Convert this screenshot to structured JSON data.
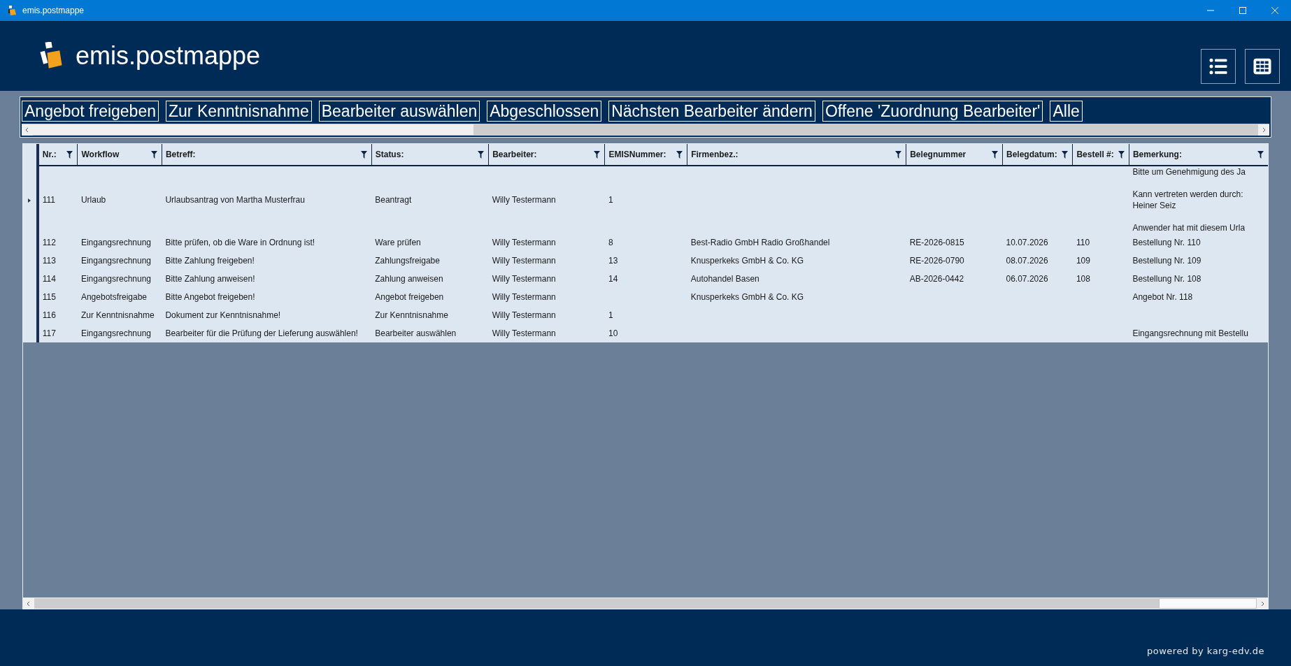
{
  "window": {
    "title": "emis.postmappe"
  },
  "app": {
    "name": "emis.postmappe"
  },
  "view_buttons": [
    {
      "kind": "list"
    },
    {
      "kind": "grid"
    }
  ],
  "filters": [
    "Angebot freigeben",
    "Zur Kenntnisnahme",
    "Bearbeiter auswählen",
    "Abgeschlossen",
    "Nächsten Bearbeiter ändern",
    "Offene 'Zuordnung Bearbeiter'",
    "Alle"
  ],
  "table": {
    "columns": [
      "Nr.:",
      "Workflow",
      "Betreff:",
      "Status:",
      "Bearbeiter:",
      "EMISNummer:",
      "Firmenbez.:",
      "Belegnummer",
      "Belegdatum:",
      "Bestell #:",
      "Bemerkung:"
    ],
    "rows": [
      {
        "selected": true,
        "cells": [
          "111",
          "Urlaub",
          "Urlaubsantrag von Martha Musterfrau",
          "Beantragt",
          "Willy Testermann",
          "1",
          "",
          "",
          "",
          "",
          ""
        ],
        "note": [
          [
            "Bitte um Genehmigung des Ja"
          ],
          [
            "Kann vertreten werden durch:",
            "Heiner Seiz"
          ],
          [
            "Anwender hat mit diesem Urla"
          ]
        ]
      },
      {
        "selected": false,
        "cells": [
          "112",
          "Eingangsrechnung",
          "Bitte prüfen, ob die Ware in Ordnung ist!",
          "Ware prüfen",
          "Willy Testermann",
          "8",
          "Best-Radio GmbH Radio Großhandel",
          "RE-2026-0815",
          "10.07.2026",
          "110",
          "Bestellung Nr. 110"
        ]
      },
      {
        "selected": false,
        "cells": [
          "113",
          "Eingangsrechnung",
          "Bitte Zahlung freigeben!",
          "Zahlungsfreigabe",
          "Willy Testermann",
          "13",
          "Knusperkeks GmbH & Co. KG",
          "RE-2026-0790",
          "08.07.2026",
          "109",
          "Bestellung Nr. 109"
        ]
      },
      {
        "selected": false,
        "cells": [
          "114",
          "Eingangsrechnung",
          "Bitte Zahlung anweisen!",
          "Zahlung anweisen",
          "Willy Testermann",
          "14",
          "Autohandel Basen",
          "AB-2026-0442",
          "06.07.2026",
          "108",
          "Bestellung Nr. 108"
        ]
      },
      {
        "selected": false,
        "cells": [
          "115",
          "Angebotsfreigabe",
          "Bitte Angebot freigeben!",
          "Angebot freigeben",
          "Willy Testermann",
          "",
          "Knusperkeks GmbH & Co. KG",
          "",
          "",
          "",
          "Angebot Nr. 118"
        ]
      },
      {
        "selected": false,
        "cells": [
          "116",
          "Zur Kenntnisnahme",
          "Dokument zur Kenntnisnahme!",
          "Zur Kenntnisnahme",
          "Willy Testermann",
          "1",
          "",
          "",
          "",
          "",
          ""
        ]
      },
      {
        "selected": false,
        "cells": [
          "117",
          "Eingangsrechnung",
          "Bearbeiter für die Prüfung der Lieferung auswählen!",
          "Bearbeiter auswählen",
          "Willy Testermann",
          "10",
          "",
          "",
          "",
          "",
          "Eingangsrechnung mit Bestellu"
        ]
      }
    ]
  },
  "footer": {
    "text": "powered by karg-edv.de"
  }
}
